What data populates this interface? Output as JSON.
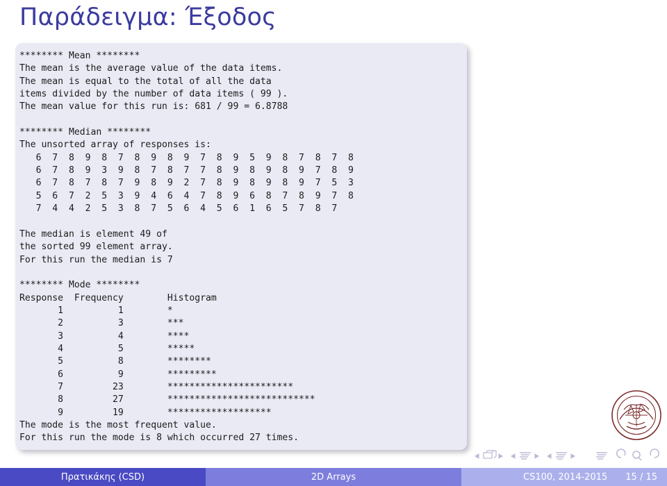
{
  "slide": {
    "title": "Παράδειγμα: Έξοδος",
    "title_color": "#3b3b9e"
  },
  "code_block": {
    "background": "#eaeaf5",
    "lines": [
      "******** Mean ********",
      "The mean is the average value of the data items.",
      "The mean is equal to the total of all the data",
      "items divided by the number of data items ( 99 ).",
      "The mean value for this run is: 681 / 99 = 6.8788",
      "",
      "******** Median ********",
      "The unsorted array of responses is:",
      "   6  7  8  9  8  7  8  9  8  9  7  8  9  5  9  8  7  8  7  8",
      "   6  7  8  9  3  9  8  7  8  7  7  8  9  8  9  8  9  7  8  9",
      "   6  7  8  7  8  7  9  8  9  2  7  8  9  8  9  8  9  7  5  3",
      "   5  6  7  2  5  3  9  4  6  4  7  8  9  6  8  7  8  9  7  8",
      "   7  4  4  2  5  3  8  7  5  6  4  5  6  1  6  5  7  8  7",
      "",
      "The median is element 49 of",
      "the sorted 99 element array.",
      "For this run the median is 7",
      "",
      "******** Mode ********",
      "Response  Frequency        Histogram",
      "       1          1        *",
      "       2          3        ***",
      "       3          4        ****",
      "       4          5        *****",
      "       5          8        ********",
      "       6          9        *********",
      "       7         23        ***********************",
      "       8         27        ***************************",
      "       9         19        *******************",
      "The mode is the most frequent value.",
      "For this run the mode is 8 which occurred 27 times."
    ]
  },
  "statistics": {
    "mean": {
      "heading": "Mean",
      "total": 681,
      "count": 99,
      "value": 6.8788
    },
    "median": {
      "heading": "Median",
      "element_index": 49,
      "array_length": 99,
      "value": 7,
      "unsorted_array": [
        [
          6,
          7,
          8,
          9,
          8,
          7,
          8,
          9,
          8,
          9,
          7,
          8,
          9,
          5,
          9,
          8,
          7,
          8,
          7,
          8
        ],
        [
          6,
          7,
          8,
          9,
          3,
          9,
          8,
          7,
          8,
          7,
          7,
          8,
          9,
          8,
          9,
          8,
          9,
          7,
          8,
          9
        ],
        [
          6,
          7,
          8,
          7,
          8,
          7,
          9,
          8,
          9,
          2,
          7,
          8,
          9,
          8,
          9,
          8,
          9,
          7,
          5,
          3
        ],
        [
          5,
          6,
          7,
          2,
          5,
          3,
          9,
          4,
          6,
          4,
          7,
          8,
          9,
          6,
          8,
          7,
          8,
          9,
          7,
          8
        ],
        [
          7,
          4,
          4,
          2,
          5,
          3,
          8,
          7,
          5,
          6,
          4,
          5,
          6,
          1,
          6,
          5,
          7,
          8,
          7
        ]
      ]
    },
    "mode": {
      "heading": "Mode",
      "columns": [
        "Response",
        "Frequency",
        "Histogram"
      ],
      "rows": [
        {
          "response": 1,
          "frequency": 1,
          "histogram": "*"
        },
        {
          "response": 2,
          "frequency": 3,
          "histogram": "***"
        },
        {
          "response": 3,
          "frequency": 4,
          "histogram": "****"
        },
        {
          "response": 4,
          "frequency": 5,
          "histogram": "*****"
        },
        {
          "response": 5,
          "frequency": 8,
          "histogram": "********"
        },
        {
          "response": 6,
          "frequency": 9,
          "histogram": "*********"
        },
        {
          "response": 7,
          "frequency": 23,
          "histogram": "***********************"
        },
        {
          "response": 8,
          "frequency": 27,
          "histogram": "***************************"
        },
        {
          "response": 9,
          "frequency": 19,
          "histogram": "*******************"
        }
      ],
      "value": 8,
      "occurrences": 27
    }
  },
  "footer": {
    "author": "Πρατικάκης (CSD)",
    "section": "2D Arrays",
    "course": "CS100, 2014-2015",
    "page": "15 / 15",
    "colors": {
      "author_bg": "#4a4ac4",
      "section_bg": "#7d7ddd",
      "meta_bg": "#abb0ec",
      "text": "#ffffff"
    }
  },
  "navigation": {
    "icons": [
      "prev-slide-icon",
      "slide-stack-icon",
      "next-slide-icon",
      "prev-frame-icon",
      "frame-icon",
      "next-frame-icon",
      "prev-subsection-icon",
      "subsection-icon",
      "next-subsection-icon",
      "section-icon",
      "back-icon",
      "search-icon",
      "forward-icon"
    ],
    "color": "#b9b9d6"
  },
  "seal": {
    "name": "university-of-crete-seal",
    "color": "#7c2b2b"
  }
}
